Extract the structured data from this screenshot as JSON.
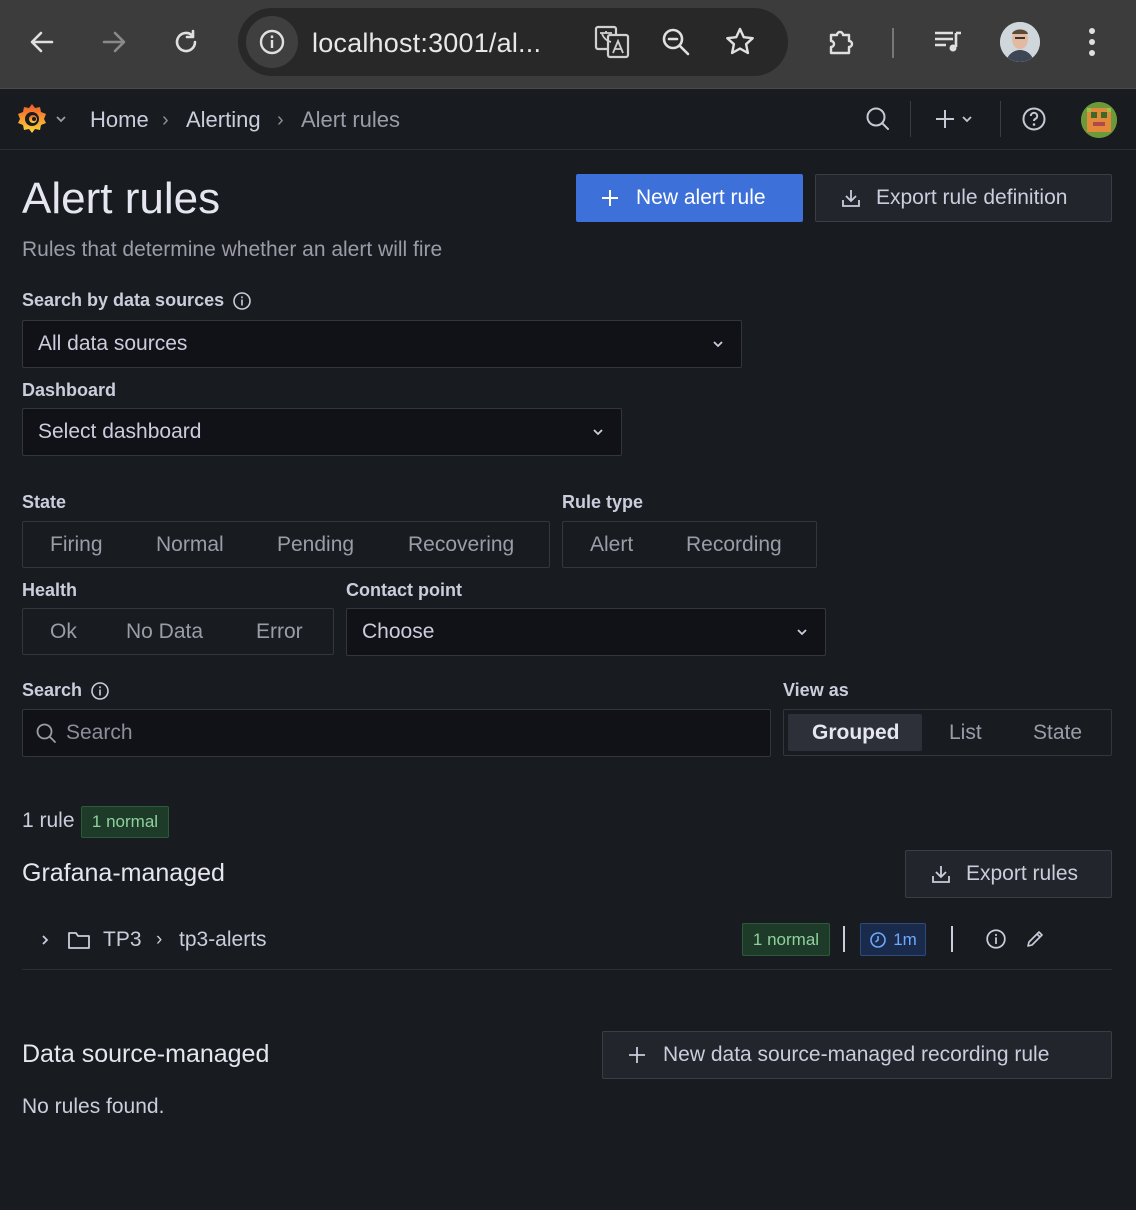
{
  "browser": {
    "url": "localhost:3001/al..."
  },
  "breadcrumbs": [
    "Home",
    "Alerting",
    "Alert rules"
  ],
  "breadcrumb_sep": "›",
  "page": {
    "title": "Alert rules",
    "subtitle": "Rules that determine whether an alert will fire",
    "new_rule_label": "New alert rule",
    "export_def_label": "Export rule definition"
  },
  "filters": {
    "datasource_label": "Search by data sources",
    "datasource_value": "All data sources",
    "dashboard_label": "Dashboard",
    "dashboard_placeholder": "Select dashboard",
    "state_label": "State",
    "state_options": [
      "Firing",
      "Normal",
      "Pending",
      "Recovering"
    ],
    "ruletype_label": "Rule type",
    "ruletype_options": [
      "Alert",
      "Recording"
    ],
    "health_label": "Health",
    "health_options": [
      "Ok",
      "No Data",
      "Error"
    ],
    "contact_label": "Contact point",
    "contact_placeholder": "Choose",
    "search_label": "Search",
    "search_placeholder": "Search",
    "viewas_label": "View as",
    "viewas_options": [
      "Grouped",
      "List",
      "State"
    ],
    "viewas_selected": "Grouped"
  },
  "summary": {
    "count": "1 rule",
    "badge": "1 normal"
  },
  "grafana_section": {
    "title": "Grafana-managed",
    "export_label": "Export rules",
    "folder": "TP3",
    "group": "tp3-alerts",
    "state_badge": "1 normal",
    "interval": "1m"
  },
  "ds_section": {
    "title": "Data source-managed",
    "new_recording_label": "New data source-managed recording rule",
    "empty_text": "No rules found."
  },
  "colors": {
    "primary": "#3d71d9",
    "background": "#181b1f",
    "normal_badge": "#8fd19e",
    "interval_badge": "#6ea8ff"
  }
}
